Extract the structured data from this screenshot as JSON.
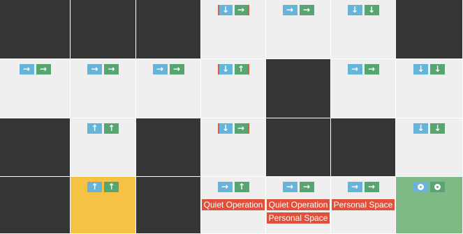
{
  "colors": {
    "dark": "#353535",
    "light": "#efefef",
    "highlight_yellow": "#f6c244",
    "highlight_green": "#7dba85",
    "arrow_blue": "#67b4db",
    "arrow_green": "#57a571",
    "tag_red": "#e1503a"
  },
  "rows": [
    [
      {
        "style": "dark"
      },
      {
        "style": "dark"
      },
      {
        "style": "dark"
      },
      {
        "style": "light",
        "arrows": [
          {
            "glyph": "↓",
            "color": "blue",
            "marker": "left"
          },
          {
            "glyph": "→",
            "color": "green",
            "marker": "right"
          }
        ]
      },
      {
        "style": "light",
        "arrows": [
          {
            "glyph": "→",
            "color": "blue"
          },
          {
            "glyph": "→",
            "color": "green"
          }
        ]
      },
      {
        "style": "light",
        "arrows": [
          {
            "glyph": "↓",
            "color": "blue"
          },
          {
            "glyph": "↓",
            "color": "green"
          }
        ]
      },
      {
        "style": "dark"
      }
    ],
    [
      {
        "style": "light",
        "arrows": [
          {
            "glyph": "→",
            "color": "blue"
          },
          {
            "glyph": "→",
            "color": "green"
          }
        ]
      },
      {
        "style": "light",
        "arrows": [
          {
            "glyph": "→",
            "color": "blue"
          },
          {
            "glyph": "→",
            "color": "green"
          }
        ]
      },
      {
        "style": "light",
        "arrows": [
          {
            "glyph": "→",
            "color": "blue"
          },
          {
            "glyph": "→",
            "color": "green"
          }
        ]
      },
      {
        "style": "light",
        "arrows": [
          {
            "glyph": "↓",
            "color": "blue",
            "marker": "left"
          },
          {
            "glyph": "↑",
            "color": "green",
            "marker": "right"
          }
        ]
      },
      {
        "style": "dark"
      },
      {
        "style": "light",
        "arrows": [
          {
            "glyph": "→",
            "color": "blue"
          },
          {
            "glyph": "→",
            "color": "green"
          }
        ]
      },
      {
        "style": "light",
        "arrows": [
          {
            "glyph": "↓",
            "color": "blue"
          },
          {
            "glyph": "↓",
            "color": "green"
          }
        ]
      }
    ],
    [
      {
        "style": "dark"
      },
      {
        "style": "light",
        "arrows": [
          {
            "glyph": "↑",
            "color": "blue"
          },
          {
            "glyph": "↑",
            "color": "green"
          }
        ]
      },
      {
        "style": "dark"
      },
      {
        "style": "light",
        "arrows": [
          {
            "glyph": "↓",
            "color": "blue",
            "marker": "left"
          },
          {
            "glyph": "→",
            "color": "green",
            "marker": "right"
          }
        ]
      },
      {
        "style": "dark"
      },
      {
        "style": "dark"
      },
      {
        "style": "light",
        "arrows": [
          {
            "glyph": "↓",
            "color": "blue"
          },
          {
            "glyph": "↓",
            "color": "green"
          }
        ]
      }
    ],
    [
      {
        "style": "dark"
      },
      {
        "style": "yellow",
        "arrows": [
          {
            "glyph": "↑",
            "color": "blue"
          },
          {
            "glyph": "↑",
            "color": "green"
          }
        ]
      },
      {
        "style": "dark"
      },
      {
        "style": "light",
        "arrows": [
          {
            "glyph": "→",
            "color": "blue"
          },
          {
            "glyph": "↑",
            "color": "green"
          }
        ],
        "tags": [
          "Quiet Operation"
        ]
      },
      {
        "style": "light",
        "arrows": [
          {
            "glyph": "→",
            "color": "blue"
          },
          {
            "glyph": "→",
            "color": "green"
          }
        ],
        "tags": [
          "Quiet Operation",
          "Personal Space"
        ]
      },
      {
        "style": "light",
        "arrows": [
          {
            "glyph": "→",
            "color": "blue"
          },
          {
            "glyph": "→",
            "color": "green"
          }
        ],
        "tags": [
          "Personal Space"
        ]
      },
      {
        "style": "green",
        "arrows": [
          {
            "glyph": "circle",
            "color": "blue"
          },
          {
            "glyph": "circle",
            "color": "green"
          }
        ]
      }
    ]
  ]
}
